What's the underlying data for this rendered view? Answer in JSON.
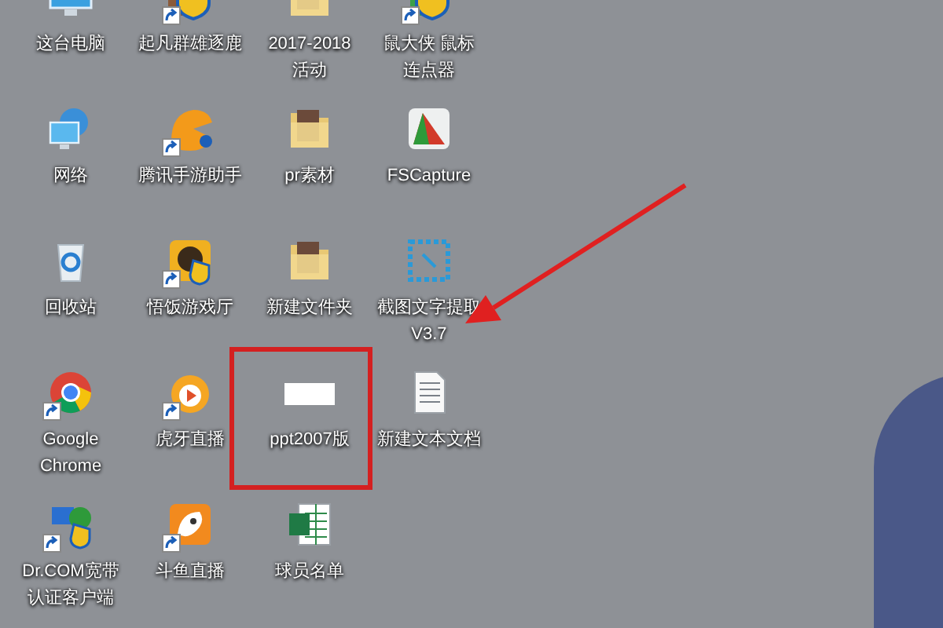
{
  "desktop": {
    "rows": [
      [
        {
          "kind": "pc",
          "label": [
            "这台电脑"
          ],
          "shortcut": false
        },
        {
          "kind": "shield-app",
          "label": [
            "起凡群雄逐鹿"
          ],
          "shortcut": true
        },
        {
          "kind": "folder",
          "label": [
            "2017-2018",
            "活动"
          ],
          "shortcut": false
        },
        {
          "kind": "mouse-app",
          "label": [
            "鼠大侠 鼠标",
            "连点器"
          ],
          "shortcut": true
        }
      ],
      [
        {
          "kind": "network",
          "label": [
            "网络"
          ],
          "shortcut": false
        },
        {
          "kind": "assistant",
          "label": [
            "腾讯手游助手"
          ],
          "shortcut": true
        },
        {
          "kind": "folder",
          "label": [
            "pr素材"
          ],
          "shortcut": false
        },
        {
          "kind": "fscapture",
          "label": [
            "FSCapture"
          ],
          "shortcut": false
        }
      ],
      [
        {
          "kind": "recycle",
          "label": [
            "回收站"
          ],
          "shortcut": false
        },
        {
          "kind": "game",
          "label": [
            "悟饭游戏厅"
          ],
          "shortcut": true
        },
        {
          "kind": "folder",
          "label": [
            "新建文件夹"
          ],
          "shortcut": false
        },
        {
          "kind": "ocr",
          "label": [
            "截图文字提取",
            "V3.7"
          ],
          "shortcut": false
        }
      ],
      [
        {
          "kind": "chrome",
          "label": [
            "Google",
            "Chrome"
          ],
          "shortcut": true
        },
        {
          "kind": "huya",
          "label": [
            "虎牙直播"
          ],
          "shortcut": true
        },
        {
          "kind": "blank",
          "label": [
            "ppt2007版"
          ],
          "shortcut": false
        },
        {
          "kind": "text",
          "label": [
            "新建文本文档"
          ],
          "shortcut": false
        }
      ],
      [
        {
          "kind": "drcom",
          "label": [
            "Dr.COM宽带",
            "认证客户端"
          ],
          "shortcut": true
        },
        {
          "kind": "douyu",
          "label": [
            "斗鱼直播"
          ],
          "shortcut": true
        },
        {
          "kind": "excel",
          "label": [
            "球员名单"
          ],
          "shortcut": false
        }
      ]
    ]
  }
}
